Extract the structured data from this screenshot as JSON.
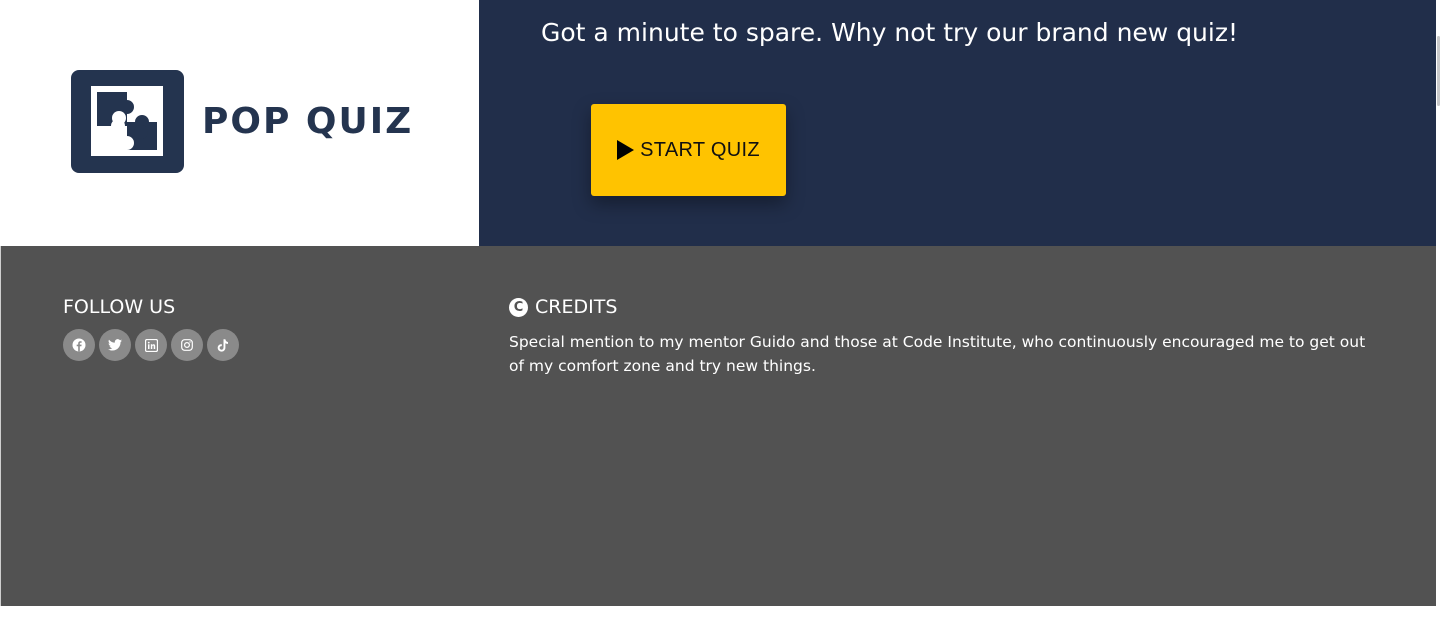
{
  "logo": {
    "text": "POP QUIZ",
    "icon": "puzzle-icon",
    "color": "#24344f"
  },
  "hero": {
    "heading": "Got a minute to spare. Why not try our brand new quiz!",
    "start_button": {
      "icon": "play-icon",
      "label": "START QUIZ",
      "color": "#ffc300"
    },
    "background": "#212e4a"
  },
  "footer": {
    "background": "#525252",
    "follow": {
      "title": "FOLLOW US",
      "socials": [
        {
          "name": "facebook-icon"
        },
        {
          "name": "twitter-icon"
        },
        {
          "name": "linkedin-icon"
        },
        {
          "name": "instagram-icon"
        },
        {
          "name": "tiktok-icon"
        }
      ]
    },
    "credits": {
      "icon": "copyright-icon",
      "icon_glyph": "C",
      "title": "CREDITS",
      "text": "Special mention to my mentor Guido and those at Code Institute, who continuously encouraged me to get out of my comfort zone and try new things."
    }
  }
}
